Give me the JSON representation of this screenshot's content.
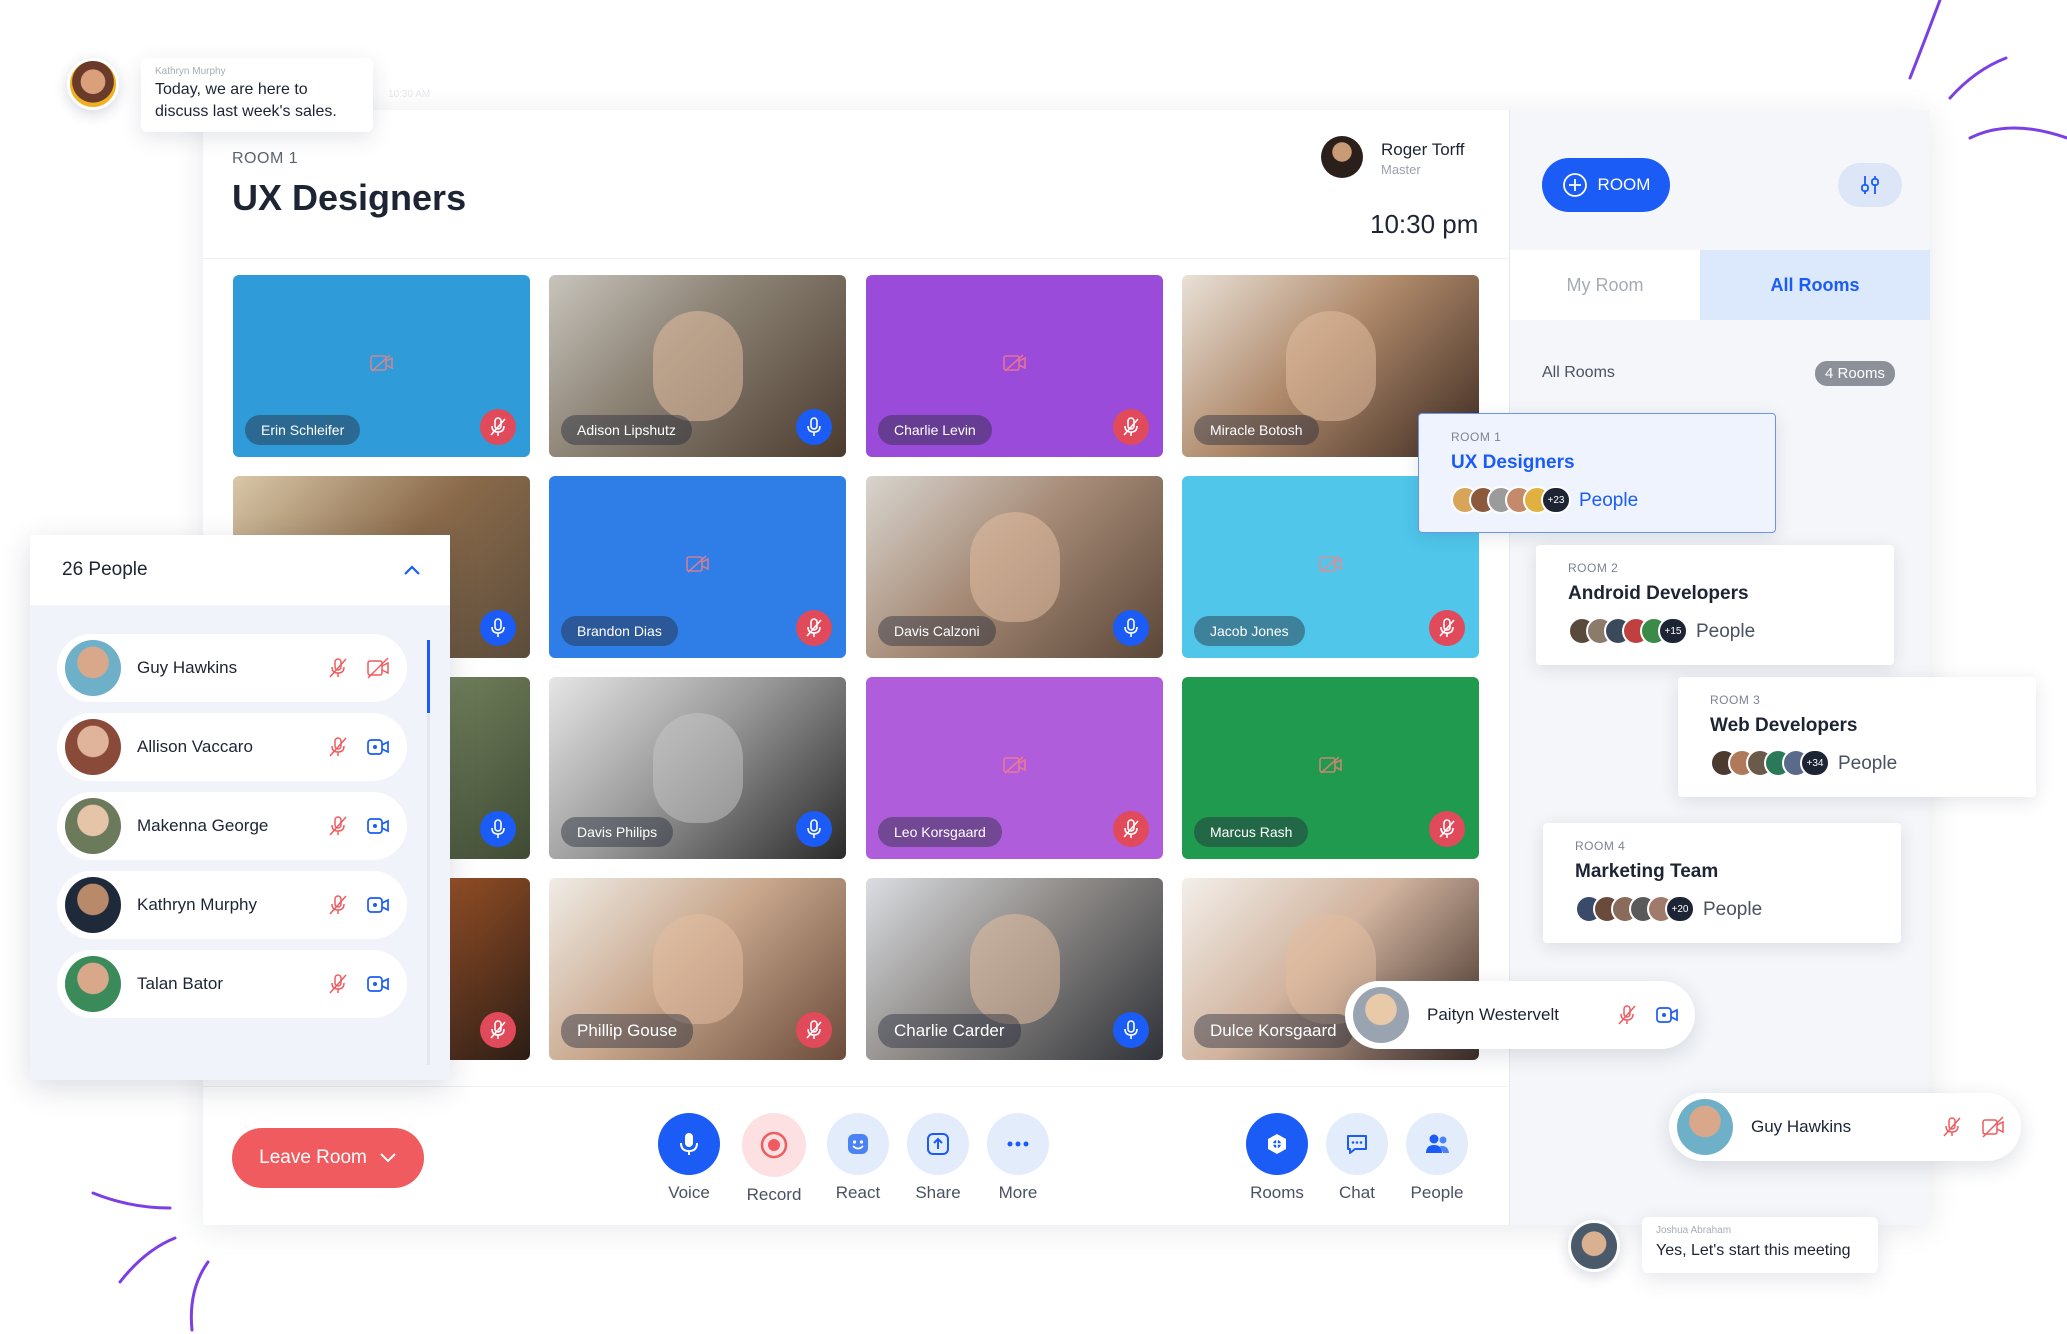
{
  "header": {
    "room_label": "ROOM 1",
    "room_title": "UX Designers",
    "host_name": "Roger Torff",
    "host_role": "Master",
    "clock": "10:30 pm"
  },
  "tiles": [
    {
      "name": "Erin Schleifer",
      "mic": "off",
      "color": "#2f9bd9"
    },
    {
      "name": "Adison Lipshutz",
      "mic": "on"
    },
    {
      "name": "Charlie Levin",
      "mic": "off",
      "color": "#9a4bd9"
    },
    {
      "name": "Miracle Botosh",
      "mic": "off"
    },
    {
      "name": "Brandon Dias",
      "mic": "off",
      "color": "#2f7de6"
    },
    {
      "name": "Davis Calzoni",
      "mic": "on"
    },
    {
      "name": "Jacob Jones",
      "mic": "off",
      "color": "#4fc6ea"
    },
    {
      "name": "Davis Philips",
      "mic": "on"
    },
    {
      "name": "Leo Korsgaard",
      "mic": "off",
      "color": "#b05ddb"
    },
    {
      "name": "Marcus Rash",
      "mic": "off",
      "color": "#1f9a4f"
    },
    {
      "name": "Phillip Gouse",
      "mic": "off"
    },
    {
      "name": "Charlie Carder",
      "mic": "on"
    },
    {
      "name": "Dulce Korsgaard",
      "mic": "off"
    }
  ],
  "controls": {
    "leave": "Leave Room",
    "voice": "Voice",
    "record": "Record",
    "react": "React",
    "share": "Share",
    "more": "More",
    "rooms": "Rooms",
    "chat": "Chat",
    "people": "People"
  },
  "rooms_panel": {
    "add_room": "ROOM",
    "tab_my": "My Room",
    "tab_all": "All Rooms",
    "list_label": "All Rooms",
    "count": "4 Rooms",
    "rooms": [
      {
        "label": "ROOM 1",
        "title": "UX Designers",
        "more": "+23",
        "people": "People"
      },
      {
        "label": "ROOM 2",
        "title": "Android Developers",
        "more": "+15",
        "people": "People"
      },
      {
        "label": "ROOM 3",
        "title": "Web Developers",
        "more": "+34",
        "people": "People"
      },
      {
        "label": "ROOM 4",
        "title": "Marketing Team",
        "more": "+20",
        "people": "People"
      }
    ]
  },
  "people_panel": {
    "title": "26 People",
    "people": [
      {
        "name": "Guy Hawkins",
        "cam": "off"
      },
      {
        "name": "Allison Vaccaro",
        "cam": "on"
      },
      {
        "name": "Makenna George",
        "cam": "on"
      },
      {
        "name": "Kathryn Murphy",
        "cam": "on"
      },
      {
        "name": "Talan Bator",
        "cam": "on"
      }
    ]
  },
  "floating": {
    "paityn": "Paityn Westervelt",
    "guy": "Guy Hawkins"
  },
  "chat": [
    {
      "author": "Kathryn Murphy",
      "text1": "Today, we are here to",
      "text2": "discuss last week's sales.",
      "time": "10:30 AM"
    },
    {
      "author": "Joshua Abraham",
      "text1": "Yes, Let's start this meeting"
    }
  ],
  "colors": {
    "accent": "#1a5cf5",
    "danger": "#ef5b5e",
    "deco": "#7b3fe4"
  }
}
